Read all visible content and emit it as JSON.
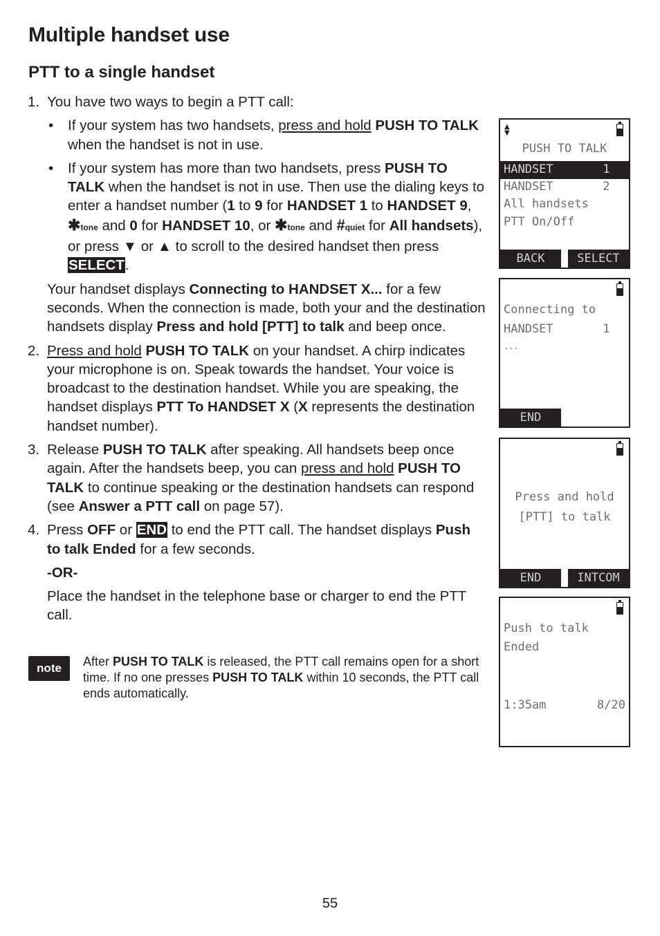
{
  "page": {
    "title": "Multiple handset use",
    "subtitle": "PTT to a single handset",
    "page_number": "55"
  },
  "steps": {
    "s1_num": "1.",
    "s1_text": "You have two ways to begin a PTT call:",
    "b1_pre": "If your system has two handsets, ",
    "b1_u": "press and hold",
    "b1_bold": " PUSH TO TALK",
    "b1_post": " when the handset is not in use.",
    "b2_a": "If your system has more than two handsets, press ",
    "b2_b": "PUSH TO TALK",
    "b2_c": " when the handset is not in use. Then use the dialing keys to enter a handset number (",
    "b2_d": "1",
    "b2_e": " to ",
    "b2_f": "9",
    "b2_g": " for ",
    "b2_h": "HANDSET 1",
    "b2_i": " to ",
    "b2_j": "HANDSET 9",
    "b2_k": ", ",
    "key_star": "✱",
    "key_star_sub": "tone",
    "b2_l": " and ",
    "b2_m": "0",
    "b2_n": " for ",
    "b2_o": "HANDSET 10",
    "b2_p": ", or ",
    "b2_q": " and ",
    "key_hash": "#",
    "key_hash_sub": "quiet",
    "b2_r": " for ",
    "b2_s": "All handsets",
    "b2_t": "), or press ▼ or ▲ to scroll to the desired handset then press ",
    "b2_select": "SELECT",
    "b2_u": ".",
    "p1_a": "Your handset displays ",
    "p1_b": "Connecting to HANDSET X...",
    "p1_c": " for a few seconds. When the connection is made, both your and the destination handsets display ",
    "p1_d": "Press and hold [PTT] to talk",
    "p1_e": " and beep once.",
    "s2_num": "2.",
    "s2_u": "Press and hold",
    "s2_b": " PUSH TO TALK",
    "s2_c": " on your handset. A chirp indicates your microphone is on. Speak towards the handset. Your voice is broadcast to the destination handset. While you are speaking, the handset displays ",
    "s2_d": "PTT To HANDSET X",
    "s2_e": " (",
    "s2_f": "X",
    "s2_g": " represents the destination handset number).",
    "s3_num": "3.",
    "s3_a": "Release ",
    "s3_b": "PUSH TO TALK",
    "s3_c": " after speaking. All handsets beep once again. After the handsets beep, you can ",
    "s3_u": "press and hold",
    "s3_d": " PUSH TO TALK",
    "s3_e": " to continue speaking or the destination handsets can respond (see ",
    "s3_f": "Answer a PTT call",
    "s3_g": " on page 57).",
    "s4_num": "4.",
    "s4_a": "Press ",
    "s4_b": "OFF",
    "s4_c": " or ",
    "s4_end": "END",
    "s4_d": " to end the PTT call. The handset displays ",
    "s4_e": "Push to talk Ended",
    "s4_f": " for a few seconds.",
    "or": "-OR-",
    "p2": "Place the handset in the telephone base or charger to end the PTT call."
  },
  "note": {
    "label": "note",
    "a": "After ",
    "b": "PUSH TO TALK",
    "c": " is released, the PTT call remains open for a short time. If no one presses ",
    "d": "PUSH TO TALK",
    "e": " within 10 seconds, the PTT call ends automatically."
  },
  "screens": {
    "s1": {
      "title": "PUSH TO TALK",
      "rows": [
        "HANDSET       1",
        "HANDSET       2",
        "All handsets",
        "PTT On/Off"
      ],
      "soft_left": "BACK",
      "soft_right": "SELECT"
    },
    "s2": {
      "line1": "Connecting to",
      "line2": "HANDSET       1",
      "line3": "...",
      "soft_left": "END"
    },
    "s3": {
      "line1": "Press and hold",
      "line2": "[PTT] to talk",
      "soft_left": "END",
      "soft_right": "INTCOM"
    },
    "s4": {
      "line1": "Push to talk",
      "line2": "Ended",
      "time": "1:35am",
      "date": "8/20"
    }
  }
}
